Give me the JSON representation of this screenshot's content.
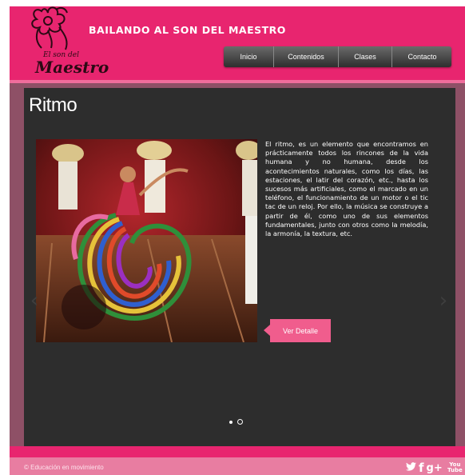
{
  "header": {
    "logo_text_small": "El son del",
    "logo_text_big": "Maestro",
    "site_title": "BAILANDO AL SON DEL MAESTRO",
    "nav": [
      {
        "label": "Inicio"
      },
      {
        "label": "Contenidos"
      },
      {
        "label": "Clases"
      },
      {
        "label": "Contacto"
      }
    ]
  },
  "main": {
    "title": "Ritmo",
    "description": "El ritmo, es un elemento que encontramos en prácticamente todos los rincones de la vida humana y no humana, desde los acontecimientos naturales, como los días, las estaciones, el latir del corazón, etc., hasta los sucesos más artificiales, como el marcado en un teléfono, el funcionamiento de un motor o el tic tac de un reloj. Por ello, la música se construye a partir de él, como uno de sus elementos fundamentales, junto con otros como la melodía, la armonía, la textura, etc.",
    "detail_button": "Ver Detalle",
    "prev_arrow": "‹",
    "next_arrow": "›",
    "slides": {
      "count": 2,
      "active_index": 0
    }
  },
  "footer": {
    "copyright": "© Educación en movimiento",
    "social": {
      "twitter": "🐦",
      "facebook": "f",
      "googleplus": "g+",
      "youtube": "You Tube"
    }
  },
  "colors": {
    "header_pink": "#e8256f",
    "panel_dark": "#2d2d2d",
    "button_pink": "#f05d8d",
    "footer_pink": "#e87da1"
  }
}
